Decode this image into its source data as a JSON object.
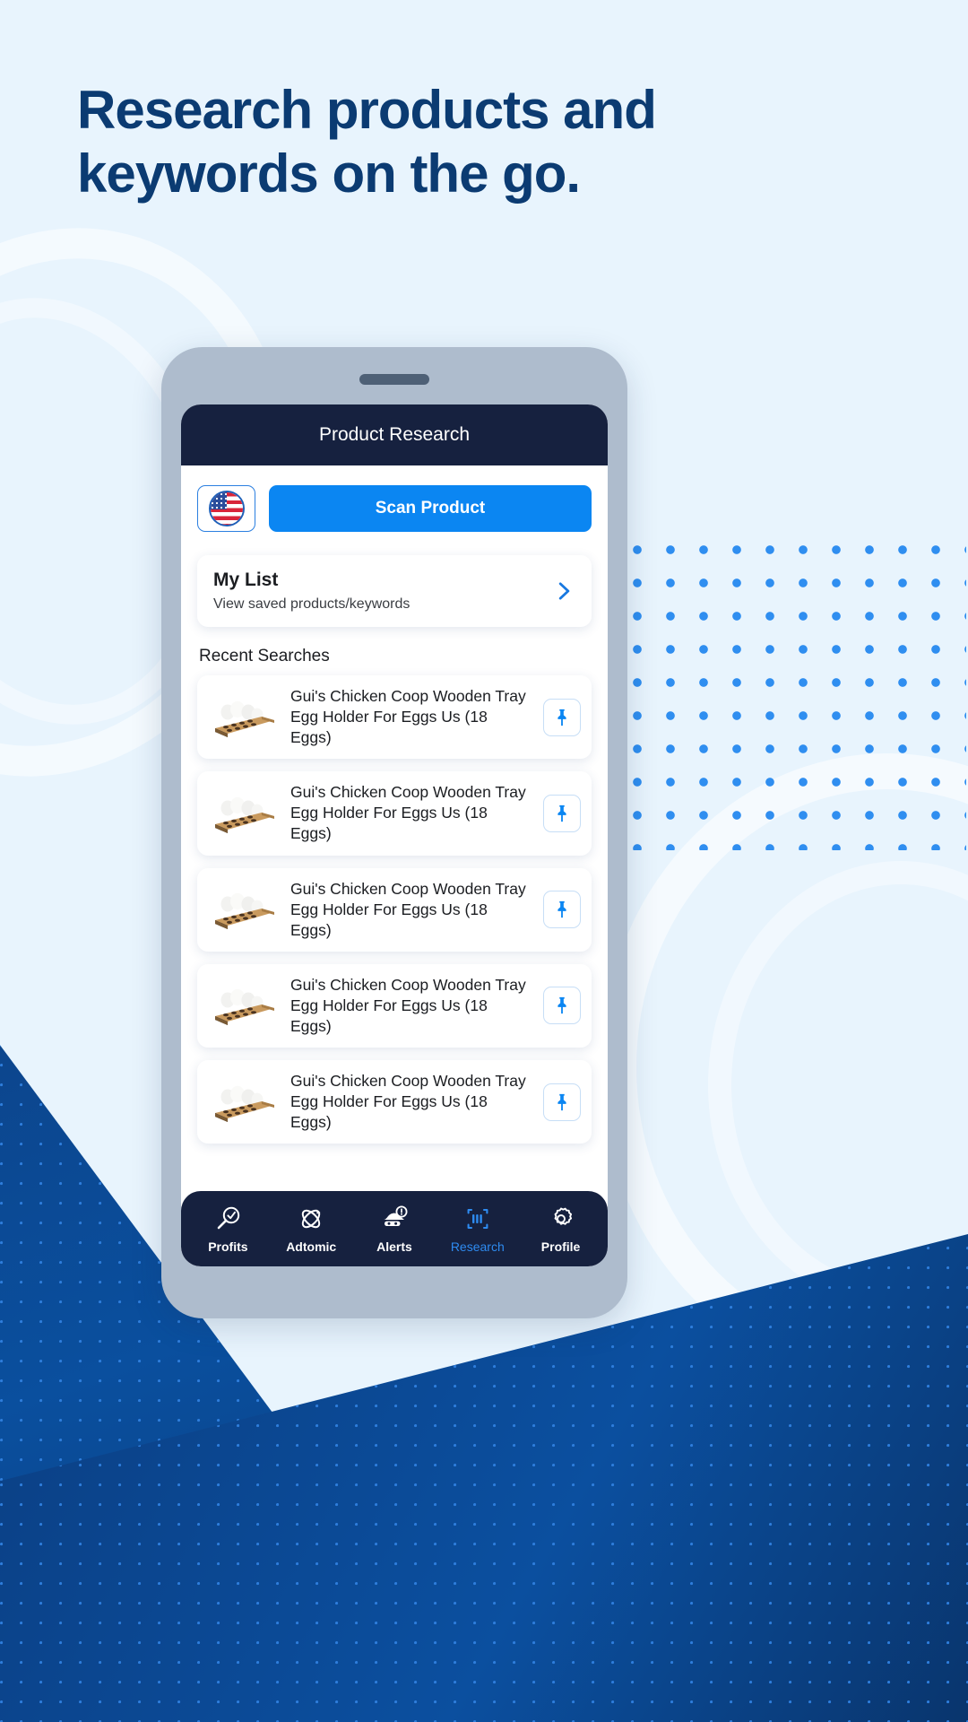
{
  "page": {
    "headline": "Research products and keywords on the go.",
    "bg_light": "#e8f4fd",
    "brand_navy": "#0b3b72",
    "accent_blue": "#0b86f2"
  },
  "phone": {
    "app_header": {
      "title": "Product Research",
      "bg": "#16213f"
    },
    "top_row": {
      "marketplace_flag": "us-flag-icon",
      "scan_button_label": "Scan Product"
    },
    "my_list": {
      "title": "My List",
      "subtitle": "View saved products/keywords",
      "chevron": "chevron-right-icon"
    },
    "recent_section_label": "Recent Searches",
    "recent_searches": [
      {
        "title": "Gui's Chicken Coop Wooden Tray Egg Holder For Eggs Us (18 Eggs)",
        "thumb": "wooden-egg-tray-image",
        "pin": "pin-icon"
      },
      {
        "title": "Gui's Chicken Coop Wooden Tray Egg Holder For Eggs Us (18 Eggs)",
        "thumb": "wooden-egg-tray-image",
        "pin": "pin-icon"
      },
      {
        "title": "Gui's Chicken Coop Wooden Tray Egg Holder For Eggs Us (18 Eggs)",
        "thumb": "wooden-egg-tray-image",
        "pin": "pin-icon"
      },
      {
        "title": "Gui's Chicken Coop Wooden Tray Egg Holder For Eggs Us (18 Eggs)",
        "thumb": "wooden-egg-tray-image",
        "pin": "pin-icon"
      },
      {
        "title": "Gui's Chicken Coop Wooden Tray Egg Holder For Eggs Us (18 Eggs)",
        "thumb": "wooden-egg-tray-image",
        "pin": "pin-icon"
      }
    ],
    "tabbar": {
      "active": "Research",
      "active_color": "#2e8bf0",
      "items": [
        {
          "label": "Profits",
          "icon": "magnifier-check-icon"
        },
        {
          "label": "Adtomic",
          "icon": "atom-icon"
        },
        {
          "label": "Alerts",
          "icon": "spy-hat-alert-icon"
        },
        {
          "label": "Research",
          "icon": "barcode-scan-icon"
        },
        {
          "label": "Profile",
          "icon": "gear-icon"
        }
      ]
    }
  }
}
